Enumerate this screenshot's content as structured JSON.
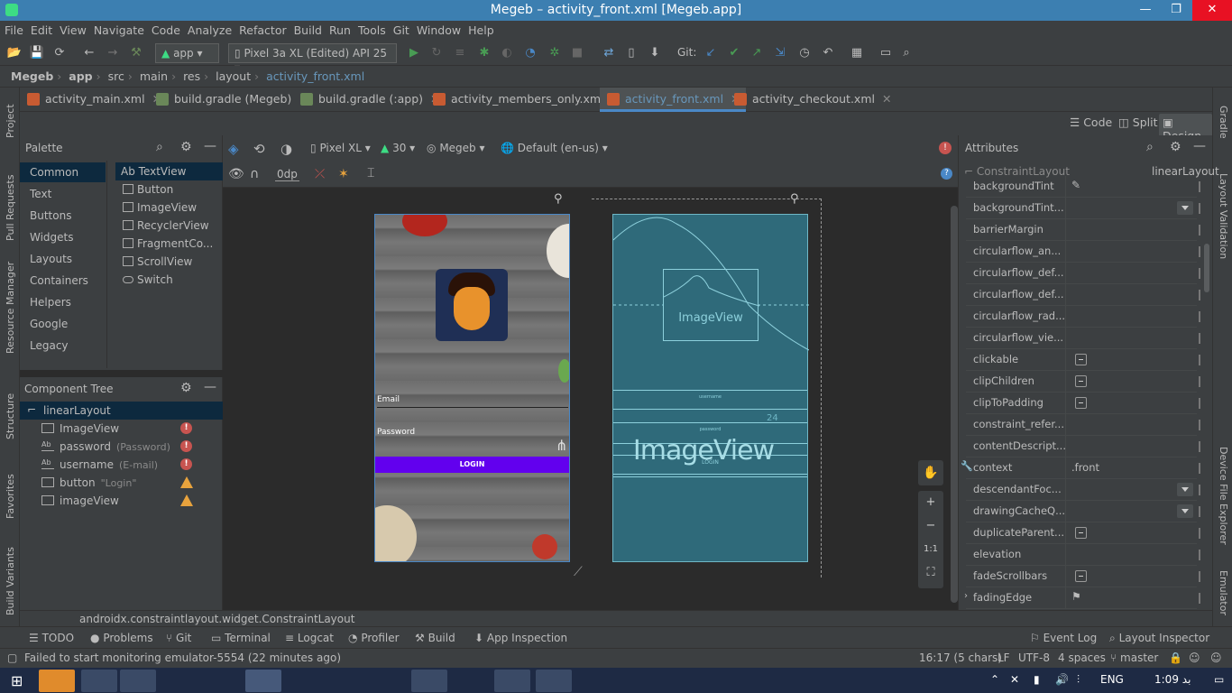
{
  "window": {
    "title": "Megeb – activity_front.xml [Megeb.app]",
    "min": "—",
    "max": "❐",
    "close": "✕"
  },
  "menu": [
    "File",
    "Edit",
    "View",
    "Navigate",
    "Code",
    "Analyze",
    "Refactor",
    "Build",
    "Run",
    "Tools",
    "Git",
    "Window",
    "Help"
  ],
  "toolbar": {
    "run_config": "app",
    "device": "Pixel 3a XL (Edited) API 25",
    "git_label": "Git:"
  },
  "breadcrumb": [
    "Megeb",
    "app",
    "src",
    "main",
    "res",
    "layout",
    "activity_front.xml"
  ],
  "tabs": [
    {
      "label": "activity_main.xml",
      "color": "#c85b32"
    },
    {
      "label": "build.gradle (Megeb)",
      "color": "#6a8759"
    },
    {
      "label": "build.gradle (:app)",
      "color": "#6a8759"
    },
    {
      "label": "activity_members_only.xml",
      "color": "#c85b32"
    },
    {
      "label": "activity_front.xml",
      "color": "#c85b32",
      "active": true
    },
    {
      "label": "activity_checkout.xml",
      "color": "#c85b32"
    }
  ],
  "view_modes": {
    "code": "Code",
    "split": "Split",
    "design": "Design"
  },
  "side_left": [
    "Project",
    "Pull Requests",
    "Resource Manager",
    "Structure",
    "Favorites",
    "Build Variants"
  ],
  "side_right": [
    "Gradle",
    "Layout Validation",
    "Device File Explorer",
    "Emulator"
  ],
  "palette": {
    "title": "Palette",
    "categories": [
      "Common",
      "Text",
      "Buttons",
      "Widgets",
      "Layouts",
      "Containers",
      "Helpers",
      "Google",
      "Legacy"
    ],
    "items": [
      "TextView",
      "Button",
      "ImageView",
      "RecyclerView",
      "FragmentCo...",
      "ScrollView",
      "Switch"
    ],
    "textview_prefix": "Ab"
  },
  "component_tree": {
    "title": "Component Tree",
    "root": "linearLayout",
    "rows": [
      {
        "name": "ImageView",
        "sub": "",
        "status": "error"
      },
      {
        "name": "password",
        "sub": "(Password)",
        "status": "error"
      },
      {
        "name": "username",
        "sub": "(E-mail)",
        "status": "error"
      },
      {
        "name": "button",
        "sub": "\"Login\"",
        "status": "warning"
      },
      {
        "name": "imageView",
        "sub": "",
        "status": "warning"
      }
    ]
  },
  "design_toolbar": {
    "device": "Pixel XL",
    "api": "30",
    "theme": "Megeb",
    "locale": "Default (en-us)",
    "margin": "0dp"
  },
  "device_preview": {
    "email": "Email",
    "password": "Password",
    "login": "LOGIN",
    "login_color": "#6200ee"
  },
  "blueprint": {
    "image_label": "ImageView",
    "image_label_big": "ImageView",
    "username": "username",
    "password": "password",
    "login": "LOGIN",
    "num": "24"
  },
  "attributes": {
    "title": "Attributes",
    "component": "ConstraintLayout",
    "id": "linearLayout",
    "rows": [
      {
        "name": "backgroundTint",
        "type": "edit"
      },
      {
        "name": "backgroundTint...",
        "type": "dropdown"
      },
      {
        "name": "barrierMargin",
        "type": "none"
      },
      {
        "name": "circularflow_an...",
        "type": "none"
      },
      {
        "name": "circularflow_def...",
        "type": "none"
      },
      {
        "name": "circularflow_def...",
        "type": "none"
      },
      {
        "name": "circularflow_rad...",
        "type": "none"
      },
      {
        "name": "circularflow_vie...",
        "type": "none"
      },
      {
        "name": "clickable",
        "type": "check"
      },
      {
        "name": "clipChildren",
        "type": "check"
      },
      {
        "name": "clipToPadding",
        "type": "check"
      },
      {
        "name": "constraint_refer...",
        "type": "none"
      },
      {
        "name": "contentDescript...",
        "type": "none"
      },
      {
        "name": "context",
        "type": "text",
        "value": ".front"
      },
      {
        "name": "descendantFoc...",
        "type": "dropdown"
      },
      {
        "name": "drawingCacheQ...",
        "type": "dropdown"
      },
      {
        "name": "duplicateParent...",
        "type": "check"
      },
      {
        "name": "elevation",
        "type": "none"
      },
      {
        "name": "fadeScrollbars",
        "type": "check"
      },
      {
        "name": "fadingEdge",
        "type": "flag"
      }
    ]
  },
  "status_class": "androidx.constraintlayout.widget.ConstraintLayout",
  "bottom_tabs": [
    "TODO",
    "Problems",
    "Git",
    "Terminal",
    "Logcat",
    "Profiler",
    "Build",
    "App Inspection",
    "Event Log",
    "Layout Inspector"
  ],
  "status": {
    "message": "Failed to start monitoring emulator-5554 (22 minutes ago)",
    "pos": "16:17 (5 chars)",
    "lf": "LF",
    "enc": "UTF-8",
    "indent": "4 spaces",
    "branch": "master"
  },
  "taskbar": {
    "lang": "ENG",
    "time": "1:09 ‏ﺑﺪ"
  }
}
